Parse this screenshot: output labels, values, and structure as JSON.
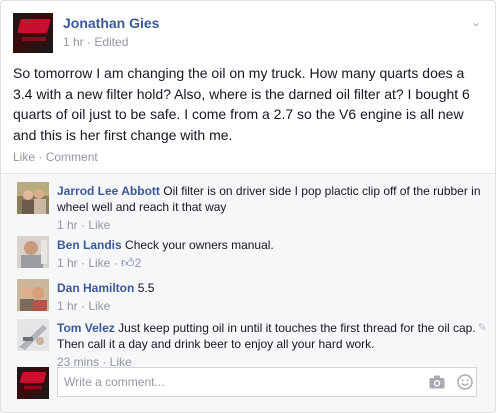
{
  "post": {
    "author": "Jonathan Gies",
    "meta": "1 hr · Edited",
    "body": "So tomorrow I am changing the oil on my truck. How many quarts does a 3.4 with a new filter hold? Also, where is the darned oil filter at? I bought 6 quarts of oil just to be safe. I come from a 2.7 so the V6 engine is all new and this is her first change with me.",
    "like_label": "Like",
    "comment_label": "Comment",
    "separator": "·"
  },
  "comments": [
    {
      "name": "Jarrod Lee Abbott",
      "text": "Oil filter is on driver side I pop plactic clip off of the rubber in wheel well and reach it that way",
      "meta": "1 hr · Like"
    },
    {
      "name": "Ben Landis",
      "text": "Check your owners manual.",
      "meta": "1 hr · Like · ",
      "likes": "2"
    },
    {
      "name": "Dan Hamilton",
      "text": "5.5",
      "meta": "1 hr · Like"
    },
    {
      "name": "Tom Velez",
      "text": "Just keep putting oil in until it touches the first thread for the oil cap. Then call it a day and drink beer to enjoy all your hard work.",
      "meta": "23 mins · Like"
    }
  ],
  "composer": {
    "placeholder": "Write a comment..."
  },
  "icons": {
    "chevron": "chevron-down-icon",
    "thumb": "thumbs-up-icon",
    "edit": "pencil-icon",
    "camera": "camera-icon",
    "emoji": "emoji-icon"
  },
  "colors": {
    "link": "#3b5998",
    "meta": "#9197a3",
    "comments_bg": "#f6f7f9"
  }
}
